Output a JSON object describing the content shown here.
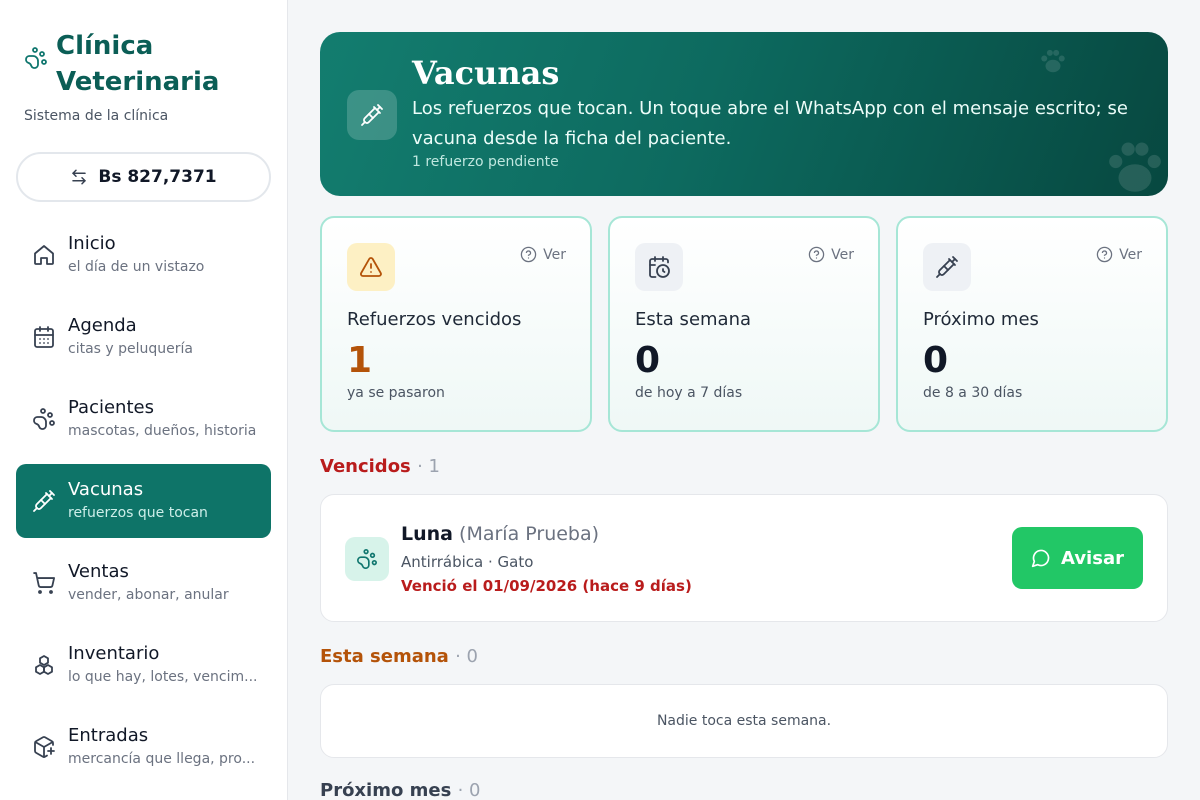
{
  "sidebar": {
    "brand": {
      "title_line1": "Clínica",
      "title_line2": "Veterinaria",
      "subtitle": "Sistema de la clínica",
      "icon": "paw-icon"
    },
    "exchange_rate": "Bs 827,7371",
    "items": [
      {
        "label": "Inicio",
        "sub": "el día de un vistazo",
        "icon": "home-icon"
      },
      {
        "label": "Agenda",
        "sub": "citas y peluquería",
        "icon": "calendar-icon"
      },
      {
        "label": "Pacientes",
        "sub": "mascotas, dueños, historia",
        "icon": "paw-icon"
      },
      {
        "label": "Vacunas",
        "sub": "refuerzos que tocan",
        "icon": "syringe-icon",
        "active": true
      },
      {
        "label": "Ventas",
        "sub": "vender, abonar, anular",
        "icon": "cart-icon"
      },
      {
        "label": "Inventario",
        "sub": "lo que hay, lotes, vencim...",
        "icon": "boxes-icon"
      },
      {
        "label": "Entradas",
        "sub": "mercancía que llega, pro...",
        "icon": "package-plus-icon"
      }
    ]
  },
  "hero": {
    "title": "Vacunas",
    "description": "Los refuerzos que tocan. Un toque abre el WhatsApp con el mensaje escrito; se vacuna desde la ficha del paciente.",
    "pending": "1 refuerzo pendiente"
  },
  "stats": [
    {
      "title": "Refuerzos vencidos",
      "value": "1",
      "note": "ya se pasaron",
      "ver": "Ver",
      "icon": "warning-icon",
      "color": "#b45309"
    },
    {
      "title": "Esta semana",
      "value": "0",
      "note": "de hoy a 7 días",
      "ver": "Ver",
      "icon": "calendar-clock-icon",
      "color": "#111827"
    },
    {
      "title": "Próximo mes",
      "value": "0",
      "note": "de 8 a 30 días",
      "ver": "Ver",
      "icon": "syringe-icon",
      "color": "#111827"
    }
  ],
  "sections": {
    "overdue": {
      "title": "Vencidos",
      "count": "· 1",
      "color": "#b91c1c"
    },
    "week": {
      "title": "Esta semana",
      "count": "· 0",
      "color": "#b45309",
      "empty": "Nadie toca esta semana."
    },
    "month": {
      "title": "Próximo mes",
      "count": "· 0",
      "color": "#374151"
    }
  },
  "overdue_items": [
    {
      "name": "Luna",
      "owner": "(María Prueba)",
      "meta": "Antirrábica · Gato",
      "due": "Venció el 01/09/2026 (hace 9 días)",
      "action": "Avisar"
    }
  ]
}
